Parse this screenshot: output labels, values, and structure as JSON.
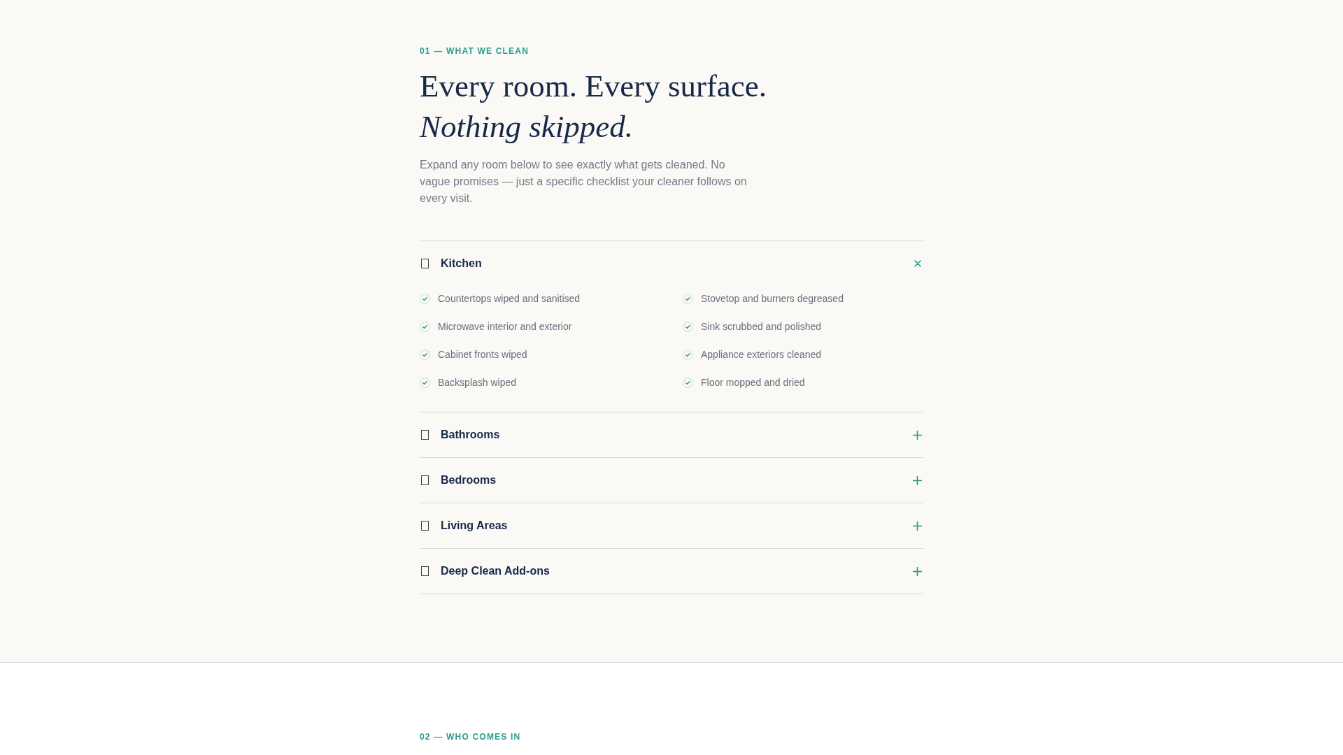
{
  "what_we_clean": {
    "eyebrow": "01 — WHAT WE CLEAN",
    "heading": "Every room. Every surface. *Nothing skipped.*",
    "intro": "Expand any room below to see exactly what gets cleaned. No vague promises — just a specific checklist your cleaner follows on every visit.",
    "rooms": [
      {
        "name": "Kitchen",
        "expanded": true,
        "items": [
          "Countertops wiped and sanitised",
          "Stovetop and burners degreased",
          "Microwave interior and exterior",
          "Sink scrubbed and polished",
          "Cabinet fronts wiped",
          "Appliance exteriors cleaned",
          "Backsplash wiped",
          "Floor mopped and dried"
        ]
      },
      {
        "name": "Bathrooms",
        "expanded": false
      },
      {
        "name": "Bedrooms",
        "expanded": false
      },
      {
        "name": "Living Areas",
        "expanded": false
      },
      {
        "name": "Deep Clean Add-ons",
        "expanded": false
      }
    ]
  },
  "who_comes_in": {
    "eyebrow": "02 — WHO COMES IN"
  }
}
